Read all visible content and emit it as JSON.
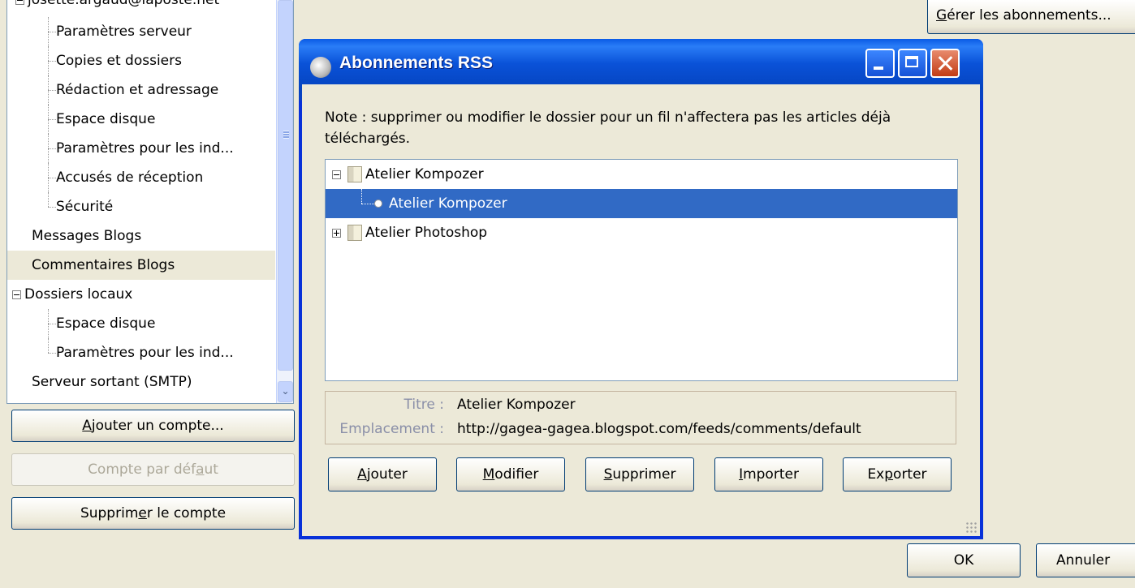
{
  "account_tree": {
    "top_cut_label": "josette.argaud@laposte.net",
    "items": [
      {
        "label": "Paramètres serveur"
      },
      {
        "label": "Copies et dossiers"
      },
      {
        "label": "Rédaction et adressage"
      },
      {
        "label": "Espace disque"
      },
      {
        "label": "Paramètres pour les ind..."
      },
      {
        "label": "Accusés de réception"
      },
      {
        "label": "Sécurité"
      },
      {
        "label": "Messages Blogs"
      },
      {
        "label": "Commentaires Blogs"
      },
      {
        "label": "Dossiers locaux"
      },
      {
        "label": "Espace disque"
      },
      {
        "label": "Paramètres pour les ind..."
      },
      {
        "label": "Serveur sortant (SMTP)"
      }
    ]
  },
  "account_buttons": {
    "add": {
      "pre": "",
      "ul": "A",
      "post": "jouter un compte..."
    },
    "default": {
      "pre": "Compte par déf",
      "ul": "a",
      "post": "ut"
    },
    "remove": {
      "pre": "Supprim",
      "ul": "e",
      "post": "r le compte"
    }
  },
  "manage_button": {
    "pre": "",
    "ul": "G",
    "post": "érer les abonnements..."
  },
  "dialog": {
    "title": "Abonnements RSS",
    "note": "Note : supprimer ou modifier le dossier pour un fil n'affectera pas les articles déjà téléchargés.",
    "feeds": [
      {
        "label": "Atelier Kompozer"
      },
      {
        "label": "Atelier Kompozer"
      },
      {
        "label": "Atelier Photoshop"
      }
    ],
    "info": {
      "title_label": "Titre :",
      "title_value": "Atelier Kompozer",
      "location_label": "Emplacement :",
      "location_value": "http://gagea-gagea.blogspot.com/feeds/comments/default"
    },
    "buttons": {
      "add": {
        "pre": "",
        "ul": "A",
        "post": "jouter"
      },
      "edit": {
        "pre": "",
        "ul": "M",
        "post": "odifier"
      },
      "delete": {
        "pre": "",
        "ul": "S",
        "post": "upprimer"
      },
      "import": {
        "pre": "",
        "ul": "I",
        "post": "mporter"
      },
      "export": {
        "pre": "Ex",
        "ul": "p",
        "post": "orter"
      }
    }
  },
  "footer": {
    "ok": "OK",
    "cancel": "Annuler"
  }
}
